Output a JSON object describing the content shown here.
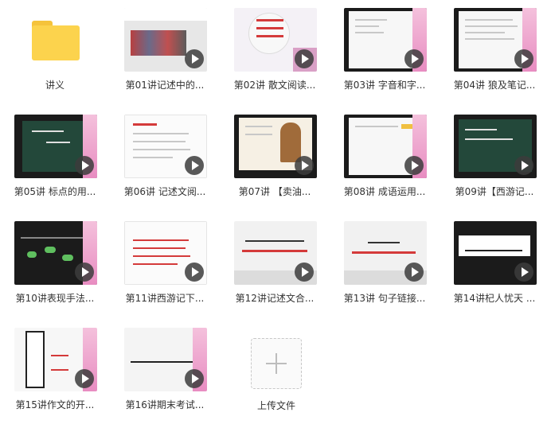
{
  "folder": {
    "label": "讲义",
    "icon": "folder-icon"
  },
  "videos": [
    {
      "label": "第01讲记述中的..."
    },
    {
      "label": "第02讲 散文阅读..."
    },
    {
      "label": "第03讲 字音和字..."
    },
    {
      "label": "第04讲 狼及笔记..."
    },
    {
      "label": "第05讲 标点的用..."
    },
    {
      "label": "第06讲 记述文阅..."
    },
    {
      "label": "第07讲 【卖油..."
    },
    {
      "label": "第08讲 成语运用..."
    },
    {
      "label": "第09讲【西游记..."
    },
    {
      "label": "第10讲表现手法..."
    },
    {
      "label": "第11讲西游记下..."
    },
    {
      "label": "第12讲记述文合..."
    },
    {
      "label": "第13讲 句子链接..."
    },
    {
      "label": "第14讲杞人忧天 ..."
    },
    {
      "label": "第15讲作文的开..."
    },
    {
      "label": "第16讲期末考试..."
    }
  ],
  "upload": {
    "label": "上传文件",
    "icon": "plus-icon"
  },
  "colors": {
    "folder": "#fcd34d",
    "play": "#3c3c3c",
    "accent_red": "#d43a3a"
  }
}
